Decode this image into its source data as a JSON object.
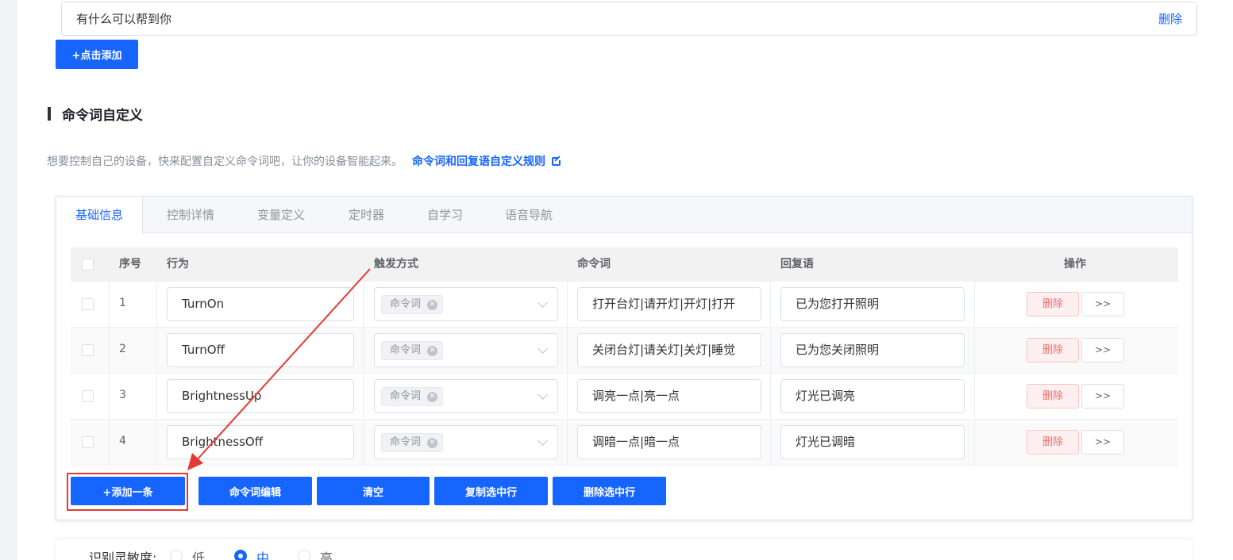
{
  "faq": {
    "question": "有什么可以帮到你",
    "delete_label": "删除",
    "add_label": "+点击添加"
  },
  "section": {
    "title": "命令词自定义",
    "description": "想要控制自己的设备，快来配置自定义命令词吧，让你的设备智能起来。",
    "rules_link": "命令词和回复语自定义规则"
  },
  "tabs": [
    "基础信息",
    "控制详情",
    "变量定义",
    "定时器",
    "自学习",
    "语音导航"
  ],
  "table": {
    "headers": {
      "index": "序号",
      "action": "行为",
      "trigger": "触发方式",
      "command": "命令词",
      "reply": "回复语",
      "ops": "操作"
    },
    "rows": [
      {
        "index": "1",
        "action": "TurnOn",
        "trigger": "命令词",
        "command": "打开台灯|请开灯|开灯|打开",
        "reply": "已为您打开照明"
      },
      {
        "index": "2",
        "action": "TurnOff",
        "trigger": "命令词",
        "command": "关闭台灯|请关灯|关灯|睡觉",
        "reply": "已为您关闭照明"
      },
      {
        "index": "3",
        "action": "BrightnessUp",
        "trigger": "命令词",
        "command": "调亮一点|亮一点",
        "reply": "灯光已调亮"
      },
      {
        "index": "4",
        "action": "BrightnessOff",
        "trigger": "命令词",
        "command": "调暗一点|暗一点",
        "reply": "灯光已调暗"
      }
    ],
    "row_delete_label": "删除",
    "row_more_label": ">>"
  },
  "actions": {
    "add_row": "+添加一条",
    "edit_commands": "命令词编辑",
    "clear": "清空",
    "copy_selected": "复制选中行",
    "delete_selected": "删除选中行"
  },
  "sensitivity": {
    "label": "识别灵敏度:",
    "options": [
      "低",
      "中",
      "高"
    ],
    "selected": "中"
  },
  "colors": {
    "primary": "#1665ff",
    "danger": "#f56c6c",
    "annotation": "#e53935"
  }
}
